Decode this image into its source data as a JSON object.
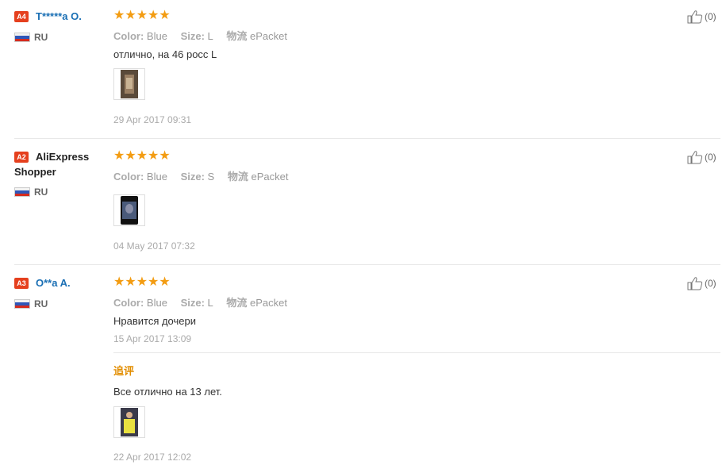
{
  "reviews": [
    {
      "level": "A4",
      "user": "T*****a O.",
      "country": "RU",
      "rating": "★★★★★",
      "color_key": "Color:",
      "color_val": "Blue",
      "size_key": "Size:",
      "size_val": "L",
      "logistics_key": "物流",
      "logistics_val": "ePacket",
      "text": "отлично, на 46 росс L",
      "date": "29 Apr 2017 09:31",
      "helpful": "(0)"
    },
    {
      "level": "A2",
      "user_line1": "AliExpress",
      "user_line2": "Shopper",
      "country": "RU",
      "rating": "★★★★★",
      "color_key": "Color:",
      "color_val": "Blue",
      "size_key": "Size:",
      "size_val": "S",
      "logistics_key": "物流",
      "logistics_val": "ePacket",
      "date": "04 May 2017 07:32",
      "helpful": "(0)"
    },
    {
      "level": "A3",
      "user": "O**a A.",
      "country": "RU",
      "rating": "★★★★★",
      "color_key": "Color:",
      "color_val": "Blue",
      "size_key": "Size:",
      "size_val": "L",
      "logistics_key": "物流",
      "logistics_val": "ePacket",
      "text": "Нравится дочери",
      "date": "15 Apr 2017 13:09",
      "additional_label": "追评",
      "additional_text": "Все отлично на 13 лет.",
      "additional_date": "22 Apr 2017 12:02",
      "helpful": "(0)"
    }
  ],
  "colors": {
    "level_badge": "#e5401e",
    "stars": "#f39c12",
    "username_link": "#1a6fb4",
    "additional_label": "#e28d00"
  },
  "icons": {
    "helpful": "thumbs-up-icon",
    "flag": "russia-flag-icon"
  }
}
